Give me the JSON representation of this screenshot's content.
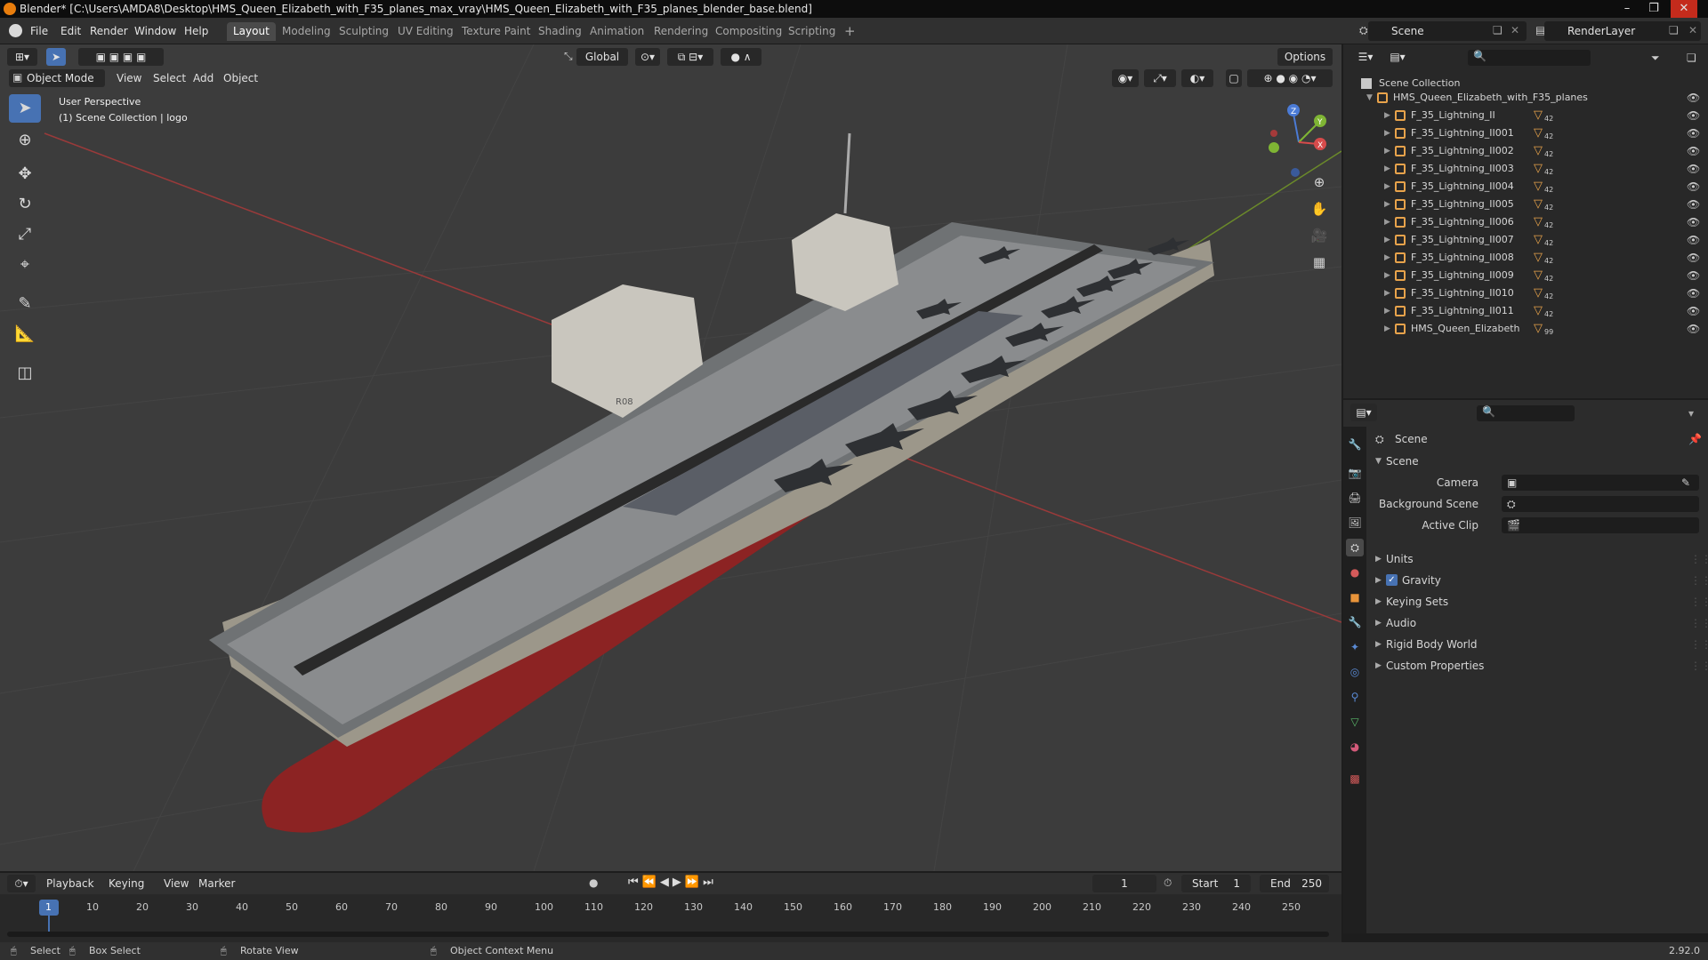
{
  "window": {
    "title": "Blender* [C:\\Users\\AMDA8\\Desktop\\HMS_Queen_Elizabeth_with_F35_planes_max_vray\\HMS_Queen_Elizabeth_with_F35_planes_blender_base.blend]",
    "minimize": "–",
    "maximize": "❐",
    "close": "✕"
  },
  "menu": [
    "File",
    "Edit",
    "Render",
    "Window",
    "Help"
  ],
  "workspaces": [
    "Layout",
    "Modeling",
    "Sculpting",
    "UV Editing",
    "Texture Paint",
    "Shading",
    "Animation",
    "Rendering",
    "Compositing",
    "Scripting"
  ],
  "workspace_add": "+",
  "scene_selector": "Scene",
  "render_layer": "RenderLayer",
  "viewport": {
    "mode": "Object Mode",
    "menus": [
      "View",
      "Select",
      "Add",
      "Object"
    ],
    "transform_orientation": "Global",
    "options": "Options",
    "overlay_line1": "User Perspective",
    "overlay_line2": "(1) Scene Collection | logo",
    "hull_number": "R08",
    "gizmo_axes": {
      "z": "Z",
      "y": "Y",
      "x": "X"
    }
  },
  "outliner": {
    "root": "Scene Collection",
    "collection": "HMS_Queen_Elizabeth_with_F35_planes",
    "items": [
      {
        "name": "F_35_Lightning_II",
        "count": "42"
      },
      {
        "name": "F_35_Lightning_II001",
        "count": "42"
      },
      {
        "name": "F_35_Lightning_II002",
        "count": "42"
      },
      {
        "name": "F_35_Lightning_II003",
        "count": "42"
      },
      {
        "name": "F_35_Lightning_II004",
        "count": "42"
      },
      {
        "name": "F_35_Lightning_II005",
        "count": "42"
      },
      {
        "name": "F_35_Lightning_II006",
        "count": "42"
      },
      {
        "name": "F_35_Lightning_II007",
        "count": "42"
      },
      {
        "name": "F_35_Lightning_II008",
        "count": "42"
      },
      {
        "name": "F_35_Lightning_II009",
        "count": "42"
      },
      {
        "name": "F_35_Lightning_II010",
        "count": "42"
      },
      {
        "name": "F_35_Lightning_II011",
        "count": "42"
      },
      {
        "name": "HMS_Queen_Elizabeth",
        "count": "99"
      }
    ]
  },
  "properties": {
    "header": "Scene",
    "section": "Scene",
    "fields": [
      {
        "label": "Camera"
      },
      {
        "label": "Background Scene"
      },
      {
        "label": "Active Clip"
      }
    ],
    "panels": [
      "Units",
      "Gravity",
      "Keying Sets",
      "Audio",
      "Rigid Body World",
      "Custom Properties"
    ],
    "gravity_checked": true
  },
  "timeline": {
    "menus": [
      "Playback",
      "Keying",
      "View",
      "Marker"
    ],
    "current_frame": "1",
    "start_label": "Start",
    "start": "1",
    "end_label": "End",
    "end": "250",
    "ticks": [
      "1",
      "10",
      "20",
      "30",
      "40",
      "50",
      "60",
      "70",
      "80",
      "90",
      "100",
      "110",
      "120",
      "130",
      "140",
      "150",
      "160",
      "170",
      "180",
      "190",
      "200",
      "210",
      "220",
      "230",
      "240",
      "250"
    ]
  },
  "statusbar": {
    "select": "Select",
    "box_select": "Box Select",
    "rotate_view": "Rotate View",
    "context_menu": "Object Context Menu",
    "version": "2.92.0"
  }
}
